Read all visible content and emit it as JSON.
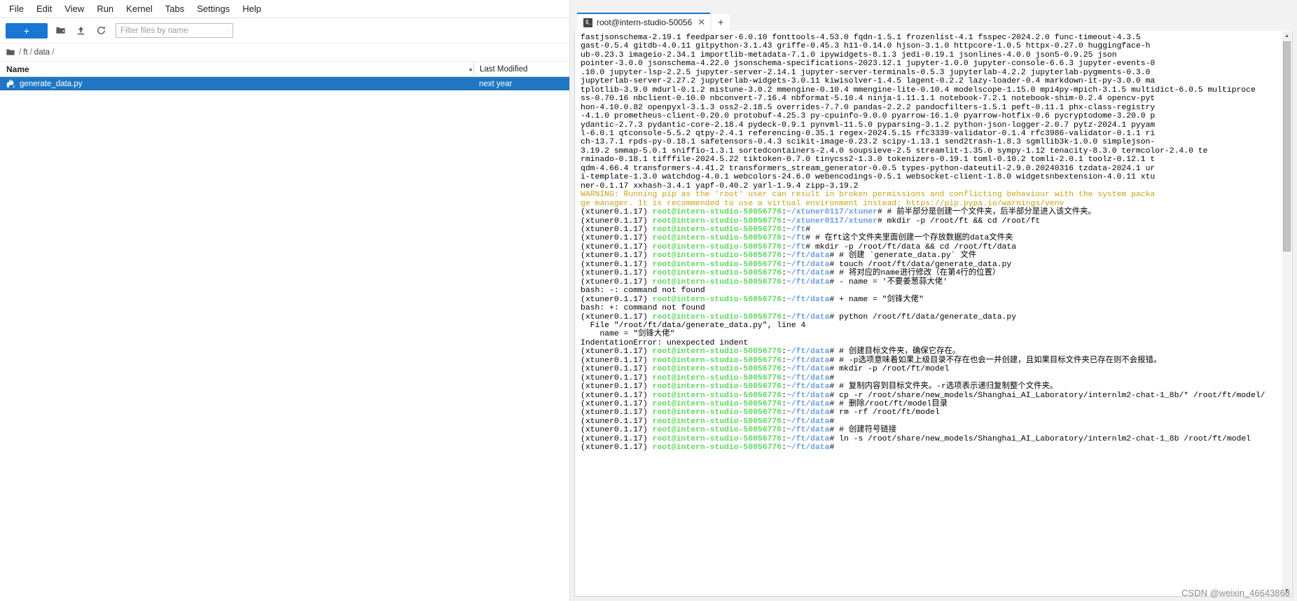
{
  "menubar": {
    "items": [
      "File",
      "Edit",
      "View",
      "Run",
      "Kernel",
      "Tabs",
      "Settings",
      "Help"
    ]
  },
  "filebrowser": {
    "new_launcher_label": "+",
    "icons": [
      "new-folder-icon",
      "upload-icon",
      "refresh-icon"
    ],
    "filter": {
      "placeholder": "Filter files by name",
      "value": ""
    },
    "breadcrumb": {
      "root_icon": "folder-icon",
      "parts": [
        "/",
        "ft",
        "/",
        "data",
        "/"
      ]
    },
    "columns": {
      "name": "Name",
      "last_modified": "Last Modified",
      "sort_arrow": "▲"
    },
    "files": [
      {
        "name": "generate_data.py",
        "icon": "python-file-icon",
        "modified": "next year",
        "selected": true
      }
    ]
  },
  "terminal_panel": {
    "tab": {
      "label": "root@intern-studio-50056",
      "icon": "terminal-icon",
      "close": "✕"
    },
    "add_tab_label": "+",
    "scrollbar": {
      "up": "▲",
      "down": "▼"
    }
  },
  "colors": {
    "accent": "#1976d2",
    "selection": "#1f77c4",
    "prompt_host": "#5fd75f",
    "prompt_path": "#6c9fe0",
    "warning": "#c8a317"
  },
  "watermark": "CSDN @weixin_46643868",
  "terminal_lines": [
    [
      {
        "t": "fastjsonschema-2.19.1 feedparser-6.0.10 fonttools-4.53.0 fqdn-1.5.1 frozenlist-4.1 fsspec-2024.2.0 func-timeout-4.3.5",
        "c": "c-white"
      }
    ],
    [
      {
        "t": "gast-0.5.4 gitdb-4.0.11 gitpython-3.1.43 griffe-0.45.3 h11-0.14.0 hjson-3.1.0 httpcore-1.0.5 httpx-0.27.0 huggingface-h",
        "c": "c-white"
      }
    ],
    [
      {
        "t": "ub-0.23.3 imageio-2.34.1 importlib-metadata-7.1.0 ipywidgets-8.1.3 jedi-0.19.1 jsonlines-4.0.0 json5-0.9.25 json",
        "c": "c-white"
      }
    ],
    [
      {
        "t": "pointer-3.0.0 jsonschema-4.22.0 jsonschema-specifications-2023.12.1 jupyter-1.0.0 jupyter-console-6.6.3 jupyter-events-0",
        "c": "c-white"
      }
    ],
    [
      {
        "t": ".10.0 jupyter-lsp-2.2.5 jupyter-server-2.14.1 jupyter-server-terminals-0.5.3 jupyterlab-4.2.2 jupyterlab-pygments-0.3.0 ",
        "c": "c-white"
      }
    ],
    [
      {
        "t": "jupyterlab-server-2.27.2 jupyterlab-widgets-3.0.11 kiwisolver-1.4.5 lagent-0.2.2 lazy-loader-0.4 markdown-it-py-3.0.0 ma",
        "c": "c-white"
      }
    ],
    [
      {
        "t": "tplotlib-3.9.0 mdurl-0.1.2 mistune-3.0.2 mmengine-0.10.4 mmengine-lite-0.10.4 modelscope-1.15.0 mpi4py-mpich-3.1.5 multidict-6.0.5 multiproce",
        "c": "c-white"
      }
    ],
    [
      {
        "t": "ss-0.70.16 nbclient-0.10.0 nbconvert-7.16.4 nbformat-5.10.4 ninja-1.11.1.1 notebook-7.2.1 notebook-shim-0.2.4 opencv-pyt",
        "c": "c-white"
      }
    ],
    [
      {
        "t": "hon-4.10.0.82 openpyxl-3.1.3 oss2-2.18.5 overrides-7.7.0 pandas-2.2.2 pandocfilters-1.5.1 peft-0.11.1 phx-class-registry",
        "c": "c-white"
      }
    ],
    [
      {
        "t": "-4.1.0 prometheus-client-0.20.0 protobuf-4.25.3 py-cpuinfo-9.0.0 pyarrow-16.1.0 pyarrow-hotfix-0.6 pycryptodome-3.20.0 p",
        "c": "c-white"
      }
    ],
    [
      {
        "t": "ydantic-2.7.3 pydantic-core-2.18.4 pydeck-0.9.1 pynvml-11.5.0 pyparsing-3.1.2 python-json-logger-2.0.7 pytz-2024.1 pyyam",
        "c": "c-white"
      }
    ],
    [
      {
        "t": "l-6.0.1 qtconsole-5.5.2 qtpy-2.4.1 referencing-0.35.1 regex-2024.5.15 rfc3339-validator-0.1.4 rfc3986-validator-0.1.1 ri",
        "c": "c-white"
      }
    ],
    [
      {
        "t": "ch-13.7.1 rpds-py-0.18.1 safetensors-0.4.3 scikit-image-0.23.2 scipy-1.13.1 send2trash-1.8.3 sgmllib3k-1.0.0 simplejson-",
        "c": "c-white"
      }
    ],
    [
      {
        "t": "3.19.2 smmap-5.0.1 sniffio-1.3.1 sortedcontainers-2.4.0 soupsieve-2.5 streamlit-1.35.0 sympy-1.12 tenacity-8.3.0 termcolor-2.4.0 te",
        "c": "c-white"
      }
    ],
    [
      {
        "t": "rminado-0.18.1 tifffile-2024.5.22 tiktoken-0.7.0 tinycss2-1.3.0 tokenizers-0.19.1 toml-0.10.2 tomli-2.0.1 toolz-0.12.1 t",
        "c": "c-white"
      }
    ],
    [
      {
        "t": "qdm-4.66.4 transformers-4.41.2 transformers_stream_generator-0.0.5 types-python-dateutil-2.9.0.20240316 tzdata-2024.1 ur",
        "c": "c-white"
      }
    ],
    [
      {
        "t": "i-template-1.3.0 watchdog-4.0.1 webcolors-24.6.0 webencodings-0.5.1 websocket-client-1.8.0 widgetsnbextension-4.0.11 xtu",
        "c": "c-white"
      }
    ],
    [
      {
        "t": "ner-0.1.17 xxhash-3.4.1 yapf-0.40.2 yarl-1.9.4 zipp-3.19.2",
        "c": "c-white"
      }
    ],
    [
      {
        "t": "WARNING: Running pip as the 'root' user can result in broken permissions and conflicting behaviour with the system packa",
        "c": "c-yellow"
      }
    ],
    [
      {
        "t": "ge manager. It is recommended to use a virtual environment instead: https://pip.pypa.io/warnings/venv",
        "c": "c-yellow"
      }
    ],
    [
      {
        "t": "(xtuner0.1.17) ",
        "c": "c-white"
      },
      {
        "t": "root@intern-studio-50056776",
        "c": "c-green"
      },
      {
        "t": ":",
        "c": "c-white"
      },
      {
        "t": "~/xtuner0117/xtuner",
        "c": "c-blue"
      },
      {
        "t": "# # 前半部分是创建一个文件夹，后半部分是进入该文件夹。",
        "c": "c-white"
      }
    ],
    [
      {
        "t": "(xtuner0.1.17) ",
        "c": "c-white"
      },
      {
        "t": "root@intern-studio-50056776",
        "c": "c-green"
      },
      {
        "t": ":",
        "c": "c-white"
      },
      {
        "t": "~/xtuner0117/xtuner",
        "c": "c-blue"
      },
      {
        "t": "# mkdir -p /root/ft && cd /root/ft",
        "c": "c-white"
      }
    ],
    [
      {
        "t": "(xtuner0.1.17) ",
        "c": "c-white"
      },
      {
        "t": "root@intern-studio-50056776",
        "c": "c-green"
      },
      {
        "t": ":",
        "c": "c-white"
      },
      {
        "t": "~/ft",
        "c": "c-blue"
      },
      {
        "t": "#",
        "c": "c-white"
      }
    ],
    [
      {
        "t": "(xtuner0.1.17) ",
        "c": "c-white"
      },
      {
        "t": "root@intern-studio-50056776",
        "c": "c-green"
      },
      {
        "t": ":",
        "c": "c-white"
      },
      {
        "t": "~/ft",
        "c": "c-blue"
      },
      {
        "t": "# # 在ft这个文件夹里面创建一个存放数据的data文件夹",
        "c": "c-white"
      }
    ],
    [
      {
        "t": "(xtuner0.1.17) ",
        "c": "c-white"
      },
      {
        "t": "root@intern-studio-50056776",
        "c": "c-green"
      },
      {
        "t": ":",
        "c": "c-white"
      },
      {
        "t": "~/ft",
        "c": "c-blue"
      },
      {
        "t": "# mkdir -p /root/ft/data && cd /root/ft/data",
        "c": "c-white"
      }
    ],
    [
      {
        "t": "(xtuner0.1.17) ",
        "c": "c-white"
      },
      {
        "t": "root@intern-studio-50056776",
        "c": "c-green"
      },
      {
        "t": ":",
        "c": "c-white"
      },
      {
        "t": "~/ft/data",
        "c": "c-blue"
      },
      {
        "t": "# # 创建 `generate_data.py` 文件",
        "c": "c-white"
      }
    ],
    [
      {
        "t": "(xtuner0.1.17) ",
        "c": "c-white"
      },
      {
        "t": "root@intern-studio-50056776",
        "c": "c-green"
      },
      {
        "t": ":",
        "c": "c-white"
      },
      {
        "t": "~/ft/data",
        "c": "c-blue"
      },
      {
        "t": "# touch /root/ft/data/generate_data.py",
        "c": "c-white"
      }
    ],
    [
      {
        "t": "(xtuner0.1.17) ",
        "c": "c-white"
      },
      {
        "t": "root@intern-studio-50056776",
        "c": "c-green"
      },
      {
        "t": ":",
        "c": "c-white"
      },
      {
        "t": "~/ft/data",
        "c": "c-blue"
      },
      {
        "t": "# # 将对应的name进行修改（在第4行的位置）",
        "c": "c-white"
      }
    ],
    [
      {
        "t": "(xtuner0.1.17) ",
        "c": "c-white"
      },
      {
        "t": "root@intern-studio-50056776",
        "c": "c-green"
      },
      {
        "t": ":",
        "c": "c-white"
      },
      {
        "t": "~/ft/data",
        "c": "c-blue"
      },
      {
        "t": "# - name = '不要姜葱蒜大佬'",
        "c": "c-white"
      }
    ],
    [
      {
        "t": "bash: -: command not found",
        "c": "c-white"
      }
    ],
    [
      {
        "t": "(xtuner0.1.17) ",
        "c": "c-white"
      },
      {
        "t": "root@intern-studio-50056776",
        "c": "c-green"
      },
      {
        "t": ":",
        "c": "c-white"
      },
      {
        "t": "~/ft/data",
        "c": "c-blue"
      },
      {
        "t": "# + name = \"剑锋大佬\"",
        "c": "c-white"
      }
    ],
    [
      {
        "t": "bash: +: command not found",
        "c": "c-white"
      }
    ],
    [
      {
        "t": "(xtuner0.1.17) ",
        "c": "c-white"
      },
      {
        "t": "root@intern-studio-50056776",
        "c": "c-green"
      },
      {
        "t": ":",
        "c": "c-white"
      },
      {
        "t": "~/ft/data",
        "c": "c-blue"
      },
      {
        "t": "# python /root/ft/data/generate_data.py",
        "c": "c-white"
      }
    ],
    [
      {
        "t": "  File \"/root/ft/data/generate_data.py\", line 4",
        "c": "c-white"
      }
    ],
    [
      {
        "t": "    name = \"剑锋大佬\"",
        "c": "c-white"
      }
    ],
    [
      {
        "t": "IndentationError: unexpected indent",
        "c": "c-white"
      }
    ],
    [
      {
        "t": "(xtuner0.1.17) ",
        "c": "c-white"
      },
      {
        "t": "root@intern-studio-50056776",
        "c": "c-green"
      },
      {
        "t": ":",
        "c": "c-white"
      },
      {
        "t": "~/ft/data",
        "c": "c-blue"
      },
      {
        "t": "# # 创建目标文件夹，确保它存在。",
        "c": "c-white"
      }
    ],
    [
      {
        "t": "(xtuner0.1.17) ",
        "c": "c-white"
      },
      {
        "t": "root@intern-studio-50056776",
        "c": "c-green"
      },
      {
        "t": ":",
        "c": "c-white"
      },
      {
        "t": "~/ft/data",
        "c": "c-blue"
      },
      {
        "t": "# # -p选项意味着如果上级目录不存在也会一并创建，且如果目标文件夹已存在则不会报错。",
        "c": "c-white"
      }
    ],
    [
      {
        "t": "(xtuner0.1.17) ",
        "c": "c-white"
      },
      {
        "t": "root@intern-studio-50056776",
        "c": "c-green"
      },
      {
        "t": ":",
        "c": "c-white"
      },
      {
        "t": "~/ft/data",
        "c": "c-blue"
      },
      {
        "t": "# mkdir -p /root/ft/model",
        "c": "c-white"
      }
    ],
    [
      {
        "t": "(xtuner0.1.17) ",
        "c": "c-white"
      },
      {
        "t": "root@intern-studio-50056776",
        "c": "c-green"
      },
      {
        "t": ":",
        "c": "c-white"
      },
      {
        "t": "~/ft/data",
        "c": "c-blue"
      },
      {
        "t": "#",
        "c": "c-white"
      }
    ],
    [
      {
        "t": "(xtuner0.1.17) ",
        "c": "c-white"
      },
      {
        "t": "root@intern-studio-50056776",
        "c": "c-green"
      },
      {
        "t": ":",
        "c": "c-white"
      },
      {
        "t": "~/ft/data",
        "c": "c-blue"
      },
      {
        "t": "# # 复制内容到目标文件夹。-r选项表示递归复制整个文件夹。",
        "c": "c-white"
      }
    ],
    [
      {
        "t": "(xtuner0.1.17) ",
        "c": "c-white"
      },
      {
        "t": "root@intern-studio-50056776",
        "c": "c-green"
      },
      {
        "t": ":",
        "c": "c-white"
      },
      {
        "t": "~/ft/data",
        "c": "c-blue"
      },
      {
        "t": "# cp -r /root/share/new_models/Shanghai_AI_Laboratory/internlm2-chat-1_8b/* /root/ft/model/",
        "c": "c-white"
      }
    ],
    [
      {
        "t": "(xtuner0.1.17) ",
        "c": "c-white"
      },
      {
        "t": "root@intern-studio-50056776",
        "c": "c-green"
      },
      {
        "t": ":",
        "c": "c-white"
      },
      {
        "t": "~/ft/data",
        "c": "c-blue"
      },
      {
        "t": "# # 删除/root/ft/model目录",
        "c": "c-white"
      }
    ],
    [
      {
        "t": "(xtuner0.1.17) ",
        "c": "c-white"
      },
      {
        "t": "root@intern-studio-50056776",
        "c": "c-green"
      },
      {
        "t": ":",
        "c": "c-white"
      },
      {
        "t": "~/ft/data",
        "c": "c-blue"
      },
      {
        "t": "# rm -rf /root/ft/model",
        "c": "c-white"
      }
    ],
    [
      {
        "t": "(xtuner0.1.17) ",
        "c": "c-white"
      },
      {
        "t": "root@intern-studio-50056776",
        "c": "c-green"
      },
      {
        "t": ":",
        "c": "c-white"
      },
      {
        "t": "~/ft/data",
        "c": "c-blue"
      },
      {
        "t": "#",
        "c": "c-white"
      }
    ],
    [
      {
        "t": "(xtuner0.1.17) ",
        "c": "c-white"
      },
      {
        "t": "root@intern-studio-50056776",
        "c": "c-green"
      },
      {
        "t": ":",
        "c": "c-white"
      },
      {
        "t": "~/ft/data",
        "c": "c-blue"
      },
      {
        "t": "# # 创建符号链接",
        "c": "c-white"
      }
    ],
    [
      {
        "t": "(xtuner0.1.17) ",
        "c": "c-white"
      },
      {
        "t": "root@intern-studio-50056776",
        "c": "c-green"
      },
      {
        "t": ":",
        "c": "c-white"
      },
      {
        "t": "~/ft/data",
        "c": "c-blue"
      },
      {
        "t": "# ln -s /root/share/new_models/Shanghai_AI_Laboratory/internlm2-chat-1_8b /root/ft/model",
        "c": "c-white"
      }
    ],
    [
      {
        "t": "(xtuner0.1.17) ",
        "c": "c-white"
      },
      {
        "t": "root@intern-studio-50056776",
        "c": "c-green"
      },
      {
        "t": ":",
        "c": "c-white"
      },
      {
        "t": "~/ft/data",
        "c": "c-blue"
      },
      {
        "t": "#",
        "c": "c-white"
      }
    ]
  ]
}
